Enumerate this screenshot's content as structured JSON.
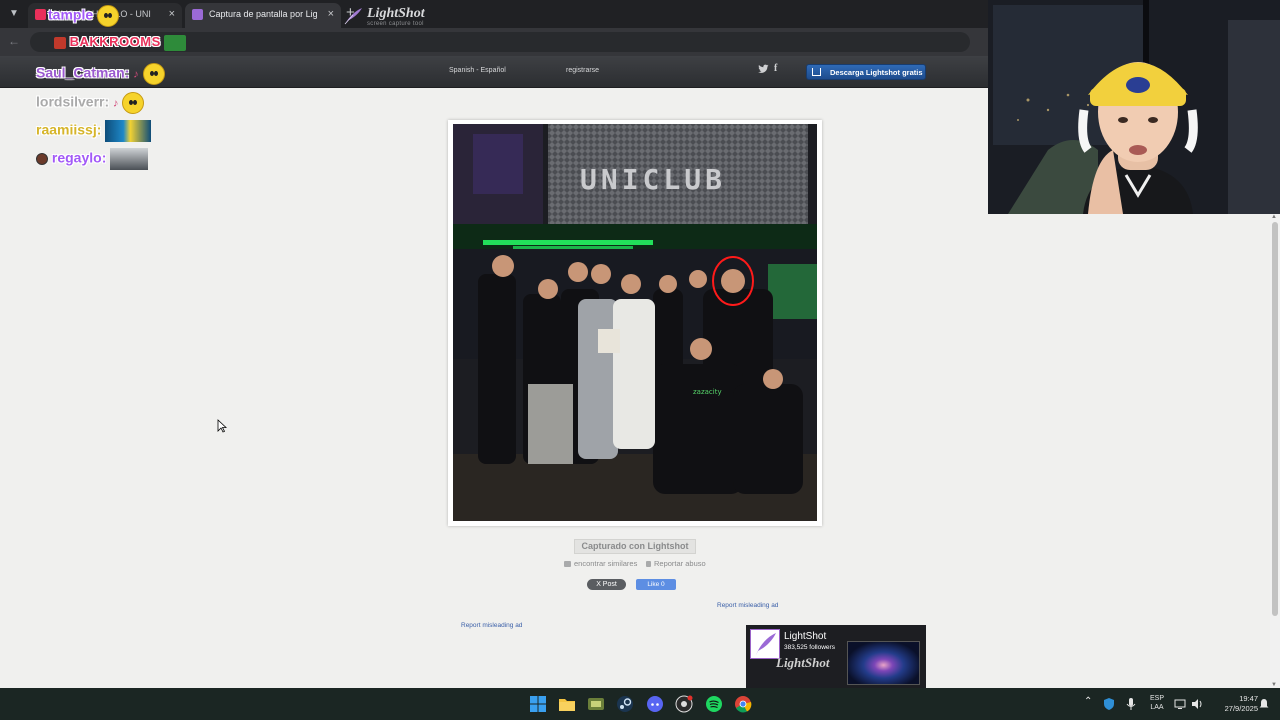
{
  "browser": {
    "tabs": [
      {
        "title": "SIMS: YOH...IQLO - UNI",
        "active": false
      },
      {
        "title": "Captura de pantalla por Lightshot",
        "active": true
      }
    ],
    "new_tab": "+",
    "close": "×"
  },
  "lightshot": {
    "logo_name": "LightShot",
    "logo_sub": "screen capture tool",
    "language": "Spanish - Español",
    "register": "registrarse",
    "download": "Descarga Lightshot gratis",
    "captured_label": "Capturado con Lightshot",
    "find_similar": "encontrar similares",
    "report_abuse": "Reportar abuso",
    "x_post": "X Post",
    "fb_like": "Like 0",
    "report_ad_1": "Report misleading ad",
    "report_ad_2": "Report misleading ad",
    "photo_sign": "UNICLUB",
    "fb_page": {
      "name": "LightShot",
      "followers": "383,525 followers",
      "watermark": "LightShot"
    }
  },
  "chat": [
    {
      "user": "tample",
      "color": "#a259f7"
    },
    {
      "user": "BAKKROOMS",
      "color": "#e9305a"
    },
    {
      "user": "Saul_Catman:",
      "color": "#9b59d0"
    },
    {
      "user": "lordsilverr:",
      "color": "#aaaaaa"
    },
    {
      "user": "raamiissj:",
      "color": "#d6b52a"
    },
    {
      "user": "regaylo:",
      "color": "#a259f7"
    }
  ],
  "system": {
    "language": "ESP",
    "layout": "LAA",
    "time": "19:47",
    "date": "27/9/2025"
  },
  "colors": {
    "page_bg": "#f0f0ee",
    "header_bg": "#35363a",
    "download_btn": "#2a5ea8",
    "taskbar_bg": "#1b2623",
    "annotation_circle": "#ff1a1a"
  },
  "icons": [
    "chevron-down-icon",
    "back-arrow-icon",
    "feather-icon",
    "twitter-icon",
    "facebook-icon",
    "download-icon",
    "windows-start-icon",
    "file-explorer-icon",
    "steam-icon",
    "discord-icon",
    "spotify-icon",
    "chrome-icon",
    "volume-icon",
    "network-icon",
    "microphone-icon"
  ]
}
